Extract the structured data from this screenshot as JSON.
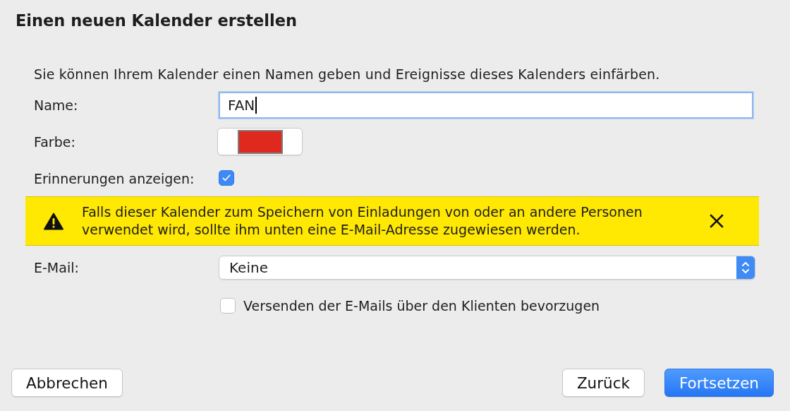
{
  "dialog": {
    "title": "Einen neuen Kalender erstellen",
    "description": "Sie können Ihrem Kalender einen Namen geben und Ereignisse dieses Kalenders einfärben.",
    "fields": [
      {
        "kind": "text",
        "label": "Name:",
        "value": "FAN",
        "focused": true
      },
      {
        "kind": "color",
        "label": "Farbe:",
        "color": "#e0291e"
      },
      {
        "kind": "checkbox",
        "label": "Erinnerungen anzeigen:",
        "checked": true
      }
    ],
    "warning": {
      "text": "Falls dieser Kalender zum Speichern von Einladungen von oder an andere Personen verwendet wird, sollte ihm unten eine E-Mail-Adresse zugewiesen werden."
    },
    "email": {
      "label": "E-Mail:",
      "value": "Keine"
    },
    "option": {
      "label": "Versenden der E-Mails über den Klienten bevorzugen",
      "checked": false
    },
    "buttons": [
      {
        "label": "Abbrechen",
        "kind": "cancel"
      },
      {
        "label": "Zurück",
        "kind": "back"
      },
      {
        "label": "Fortsetzen",
        "kind": "primary"
      }
    ]
  }
}
